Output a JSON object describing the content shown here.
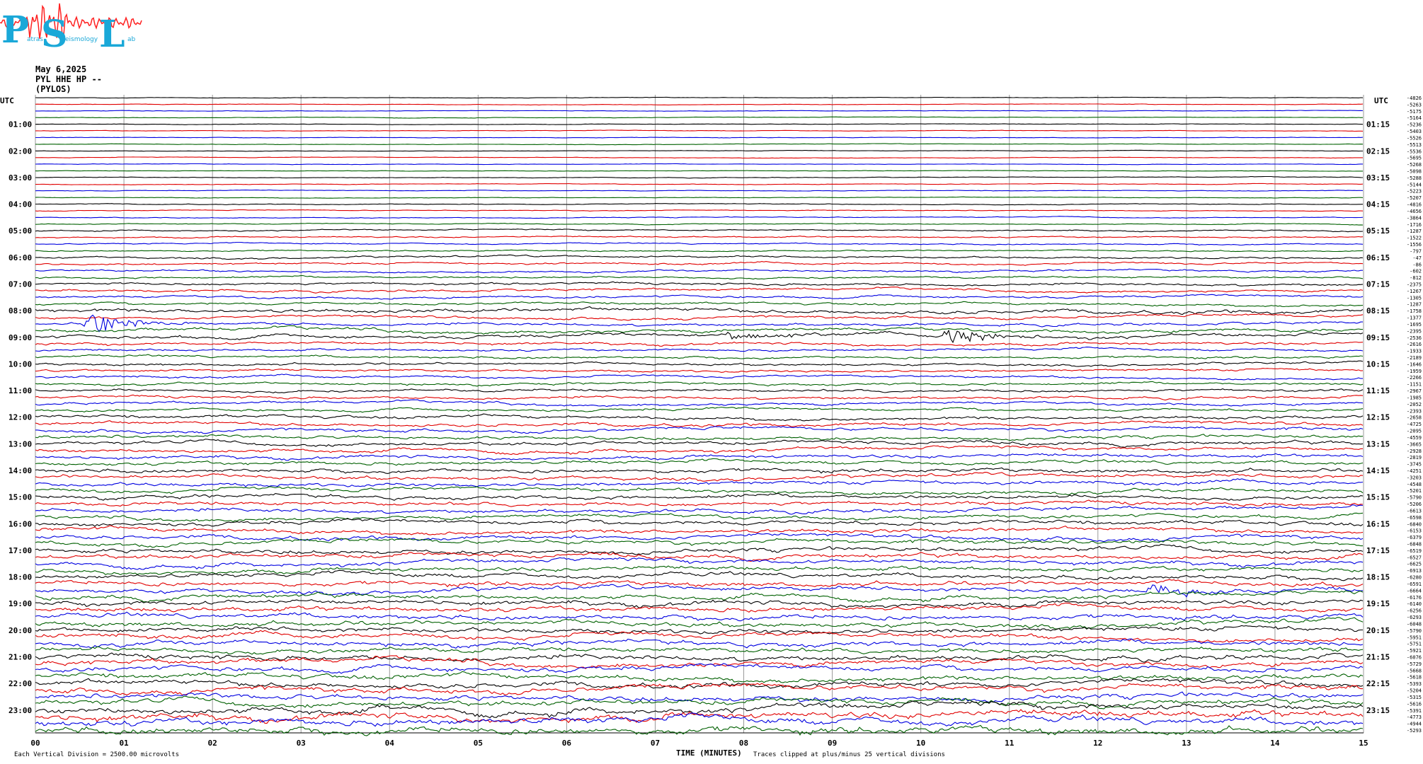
{
  "header": {
    "logo_letters": [
      "P",
      "S",
      "L"
    ],
    "logo_text_parts": [
      "atras",
      "eismology",
      "ab"
    ],
    "date": "May 6,2025",
    "station": "PYL HHE HP --",
    "location": "(PYLOS)"
  },
  "colors": {
    "trace_cycle": [
      "#000000",
      "#e00000",
      "#0000e0",
      "#006000"
    ],
    "logo": "#1aa8d8",
    "logo_wave": "#ff2020",
    "grid": "#999999"
  },
  "chart_data": {
    "type": "line",
    "title": "",
    "xlabel": "TIME (MINUTES)",
    "xlim": [
      0,
      15
    ],
    "x_ticks": [
      "00",
      "01",
      "02",
      "03",
      "04",
      "05",
      "06",
      "07",
      "08",
      "09",
      "10",
      "11",
      "12",
      "13",
      "14",
      "15"
    ],
    "left_axis_label": "UTC",
    "right_axis_label": "UTC",
    "left_hour_labels": [
      "01:00",
      "02:00",
      "03:00",
      "04:00",
      "05:00",
      "06:00",
      "07:00",
      "08:00",
      "09:00",
      "10:00",
      "11:00",
      "12:00",
      "13:00",
      "14:00",
      "15:00",
      "16:00",
      "17:00",
      "18:00",
      "19:00",
      "20:00",
      "21:00",
      "22:00",
      "23:00"
    ],
    "right_hour_labels": [
      "01:15",
      "02:15",
      "03:15",
      "04:15",
      "05:15",
      "06:15",
      "07:15",
      "08:15",
      "09:15",
      "10:15",
      "11:15",
      "12:15",
      "13:15",
      "14:15",
      "15:15",
      "16:15",
      "17:15",
      "18:15",
      "19:15",
      "20:15",
      "21:15",
      "22:15",
      "23:15"
    ],
    "trace_offsets": [
      -4826,
      -5263,
      -5175,
      -5164,
      -5236,
      -5403,
      -5526,
      -5513,
      -5536,
      -5695,
      -5268,
      -5098,
      -5288,
      -5144,
      -5223,
      -5207,
      -4816,
      -4656,
      -3864,
      -1716,
      -1287,
      -1522,
      -1556,
      -797,
      -47,
      -86,
      -602,
      -812,
      -2375,
      -1267,
      -1305,
      -1287,
      -1758,
      -1377,
      -1695,
      -2395,
      -2536,
      -2616,
      -1933,
      -2189,
      -1646,
      -1959,
      -2266,
      -1151,
      -2967,
      -1985,
      -2052,
      -2393,
      -2658,
      -4725,
      -2095,
      -4559,
      -3665,
      -2928,
      -2819,
      -3745,
      -4251,
      -3203,
      -4548,
      -5201,
      -5790,
      -5206,
      -6613,
      -6598,
      -6840,
      -6153,
      -6379,
      -6848,
      -6519,
      -6527,
      -6625,
      -6913,
      -6280,
      -6591,
      -6664,
      -6176,
      -6140,
      -6256,
      -6293,
      -6048,
      -5790,
      -5951,
      -5751,
      -5921,
      -6076,
      -5729,
      -5668,
      -5618,
      -5393,
      -5204,
      -5315,
      -5616,
      -5391,
      -4773,
      -4944,
      -5293
    ],
    "trace_activity": [
      0.5,
      0.5,
      0.5,
      0.5,
      0.5,
      0.5,
      0.5,
      0.5,
      0.5,
      0.5,
      0.5,
      0.5,
      0.6,
      0.6,
      0.6,
      0.6,
      0.7,
      0.7,
      0.8,
      0.8,
      1.2,
      1.3,
      1.2,
      1.2,
      1.8,
      1.8,
      1.8,
      1.8,
      2.2,
      2.2,
      2.2,
      2.2,
      3.5,
      2.5,
      2.5,
      3.2,
      3.2,
      2.5,
      2.2,
      2.2,
      2.2,
      2.2,
      2.2,
      2.2,
      2.5,
      2.5,
      2.5,
      2.5,
      3.0,
      3.0,
      3.0,
      3.0,
      3.2,
      3.2,
      3.2,
      3.2,
      3.5,
      3.5,
      3.5,
      3.5,
      3.5,
      3.5,
      3.5,
      3.5,
      3.8,
      3.8,
      3.8,
      3.8,
      4.0,
      4.0,
      4.0,
      4.0,
      4.2,
      4.2,
      4.2,
      4.2,
      4.5,
      4.5,
      4.5,
      4.5,
      4.5,
      4.5,
      4.5,
      4.5,
      4.8,
      4.8,
      4.8,
      4.8,
      5.0,
      5.0,
      5.0,
      5.0,
      6.0,
      6.5,
      6.5,
      6.5
    ],
    "events": [
      {
        "trace": 34,
        "minute": 0.6,
        "amplitude": 3.0
      },
      {
        "trace": 36,
        "minute": 10.3,
        "amplitude": 2.2
      },
      {
        "trace": 36,
        "minute": 7.8,
        "amplitude": 1.4
      },
      {
        "trace": 74,
        "minute": 12.6,
        "amplitude": 2.0
      }
    ],
    "footer_left": "Each Vertical Division = 2500.00 microvolts",
    "footer_right": "Traces clipped at plus/minus 25 vertical divisions"
  }
}
